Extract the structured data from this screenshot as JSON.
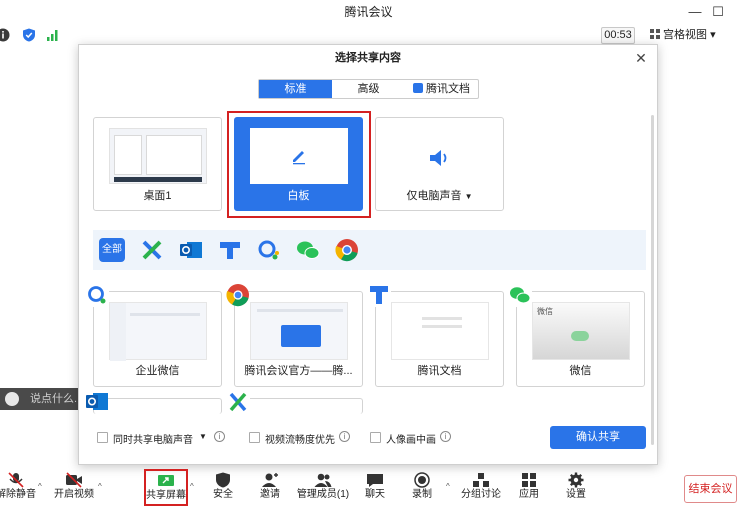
{
  "window": {
    "title": "腾讯会议"
  },
  "top_toolbar": {
    "timer": "00:53",
    "grid_view": "宫格视图"
  },
  "chat_hint": "说点什么...",
  "dialog": {
    "title": "选择共享内容",
    "tabs": [
      {
        "label": "标准",
        "active": true
      },
      {
        "label": "高级",
        "active": false
      },
      {
        "label": "腾讯文档",
        "active": false
      }
    ],
    "top_cards": [
      {
        "label": "桌面1"
      },
      {
        "label": "白板",
        "selected": true
      },
      {
        "label": "仅电脑声音"
      }
    ],
    "app_filter": {
      "all_label": "全部"
    },
    "windows": [
      {
        "label": "企业微信"
      },
      {
        "label": "腾讯会议官方——腾..."
      },
      {
        "label": "腾讯文档"
      },
      {
        "label": "微信",
        "thumb_title": "微信"
      }
    ],
    "options": [
      {
        "label": "同时共享电脑声音"
      },
      {
        "label": "视频流畅度优先"
      },
      {
        "label": "人像画中画"
      }
    ],
    "confirm_label": "确认共享"
  },
  "bottom_toolbar": {
    "items": [
      {
        "label": "解除静音"
      },
      {
        "label": "开启视频"
      },
      {
        "label": "共享屏幕"
      },
      {
        "label": "安全"
      },
      {
        "label": "邀请"
      },
      {
        "label": "管理成员(1)"
      },
      {
        "label": "聊天"
      },
      {
        "label": "录制"
      },
      {
        "label": "分组讨论"
      },
      {
        "label": "应用"
      },
      {
        "label": "设置"
      }
    ],
    "end_label": "结束会议"
  },
  "colors": {
    "accent": "#2a74e8",
    "highlight": "#d42121"
  }
}
